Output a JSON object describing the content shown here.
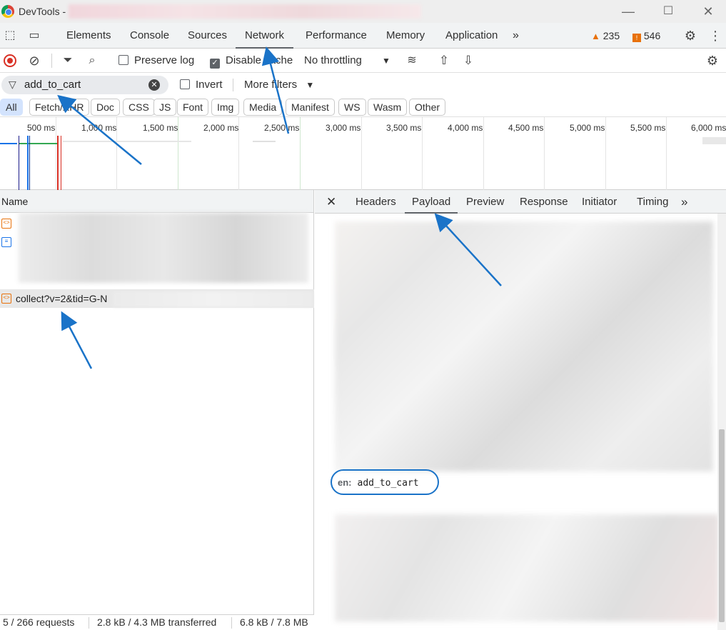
{
  "window": {
    "title": "DevTools - "
  },
  "devtools_tabs": [
    "Elements",
    "Console",
    "Sources",
    "Network",
    "Performance",
    "Memory",
    "Application"
  ],
  "active_tab": "Network",
  "badges": {
    "warnings": "235",
    "errors": "546"
  },
  "toolbar": {
    "preserve_log": "Preserve log",
    "disable_cache": "Disable cache",
    "throttling": "No throttling"
  },
  "filter": {
    "value": "add_to_cart",
    "invert": "Invert",
    "more_filters": "More filters"
  },
  "type_filters": [
    "All",
    "Fetch/XHR",
    "Doc",
    "CSS",
    "JS",
    "Font",
    "Img",
    "Media",
    "Manifest",
    "WS",
    "Wasm",
    "Other"
  ],
  "timeline_ticks": [
    "500 ms",
    "1,000 ms",
    "1,500 ms",
    "2,000 ms",
    "2,500 ms",
    "3,000 ms",
    "3,500 ms",
    "4,000 ms",
    "4,500 ms",
    "5,000 ms",
    "5,500 ms",
    "6,000 ms"
  ],
  "request_list": {
    "column_name": "Name",
    "selected_request": "collect?v=2&tid=G-N"
  },
  "status": {
    "requests": "5 / 266 requests",
    "transferred": "2.8 kB / 4.3 MB transferred",
    "resources": "6.8 kB / 7.8 MB"
  },
  "detail_tabs": [
    "Headers",
    "Payload",
    "Preview",
    "Response",
    "Initiator",
    "Timing"
  ],
  "active_detail_tab": "Payload",
  "payload": {
    "key": "en:",
    "value": "add_to_cart"
  },
  "colors": {
    "annotation": "#1a73c8",
    "record": "#d93025",
    "warning": "#e8710a"
  }
}
